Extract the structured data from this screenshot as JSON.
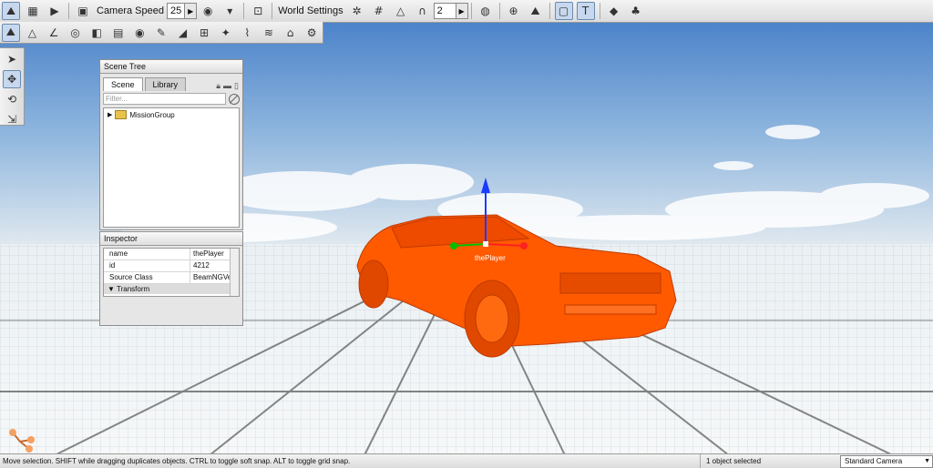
{
  "toolbar": {
    "camera_speed_label": "Camera Speed",
    "camera_speed_value": "25",
    "world_settings_label": "World Settings",
    "grid_value": "2"
  },
  "scene_tree": {
    "title": "Scene Tree",
    "tabs": [
      "Scene",
      "Library"
    ],
    "filter_placeholder": "Filter...",
    "items": [
      {
        "label": "MissionGroup"
      }
    ]
  },
  "inspector": {
    "title": "Inspector",
    "properties": [
      {
        "name": "name",
        "value": "thePlayer"
      },
      {
        "name": "id",
        "value": "4212"
      },
      {
        "name": "Source Class",
        "value": "BeamNGVeh"
      }
    ],
    "group": "Transform"
  },
  "viewport": {
    "object_label": "thePlayer"
  },
  "status_bar": {
    "message": "Move selection.  SHIFT while dragging duplicates objects.  CTRL to toggle soft snap.  ALT to toggle grid snap.",
    "selection": "1 object selected",
    "camera": "Standard Camera"
  },
  "colors": {
    "sky_top": "#3e79c9",
    "vehicle": "#ff5500",
    "ground": "#e9eef2"
  }
}
